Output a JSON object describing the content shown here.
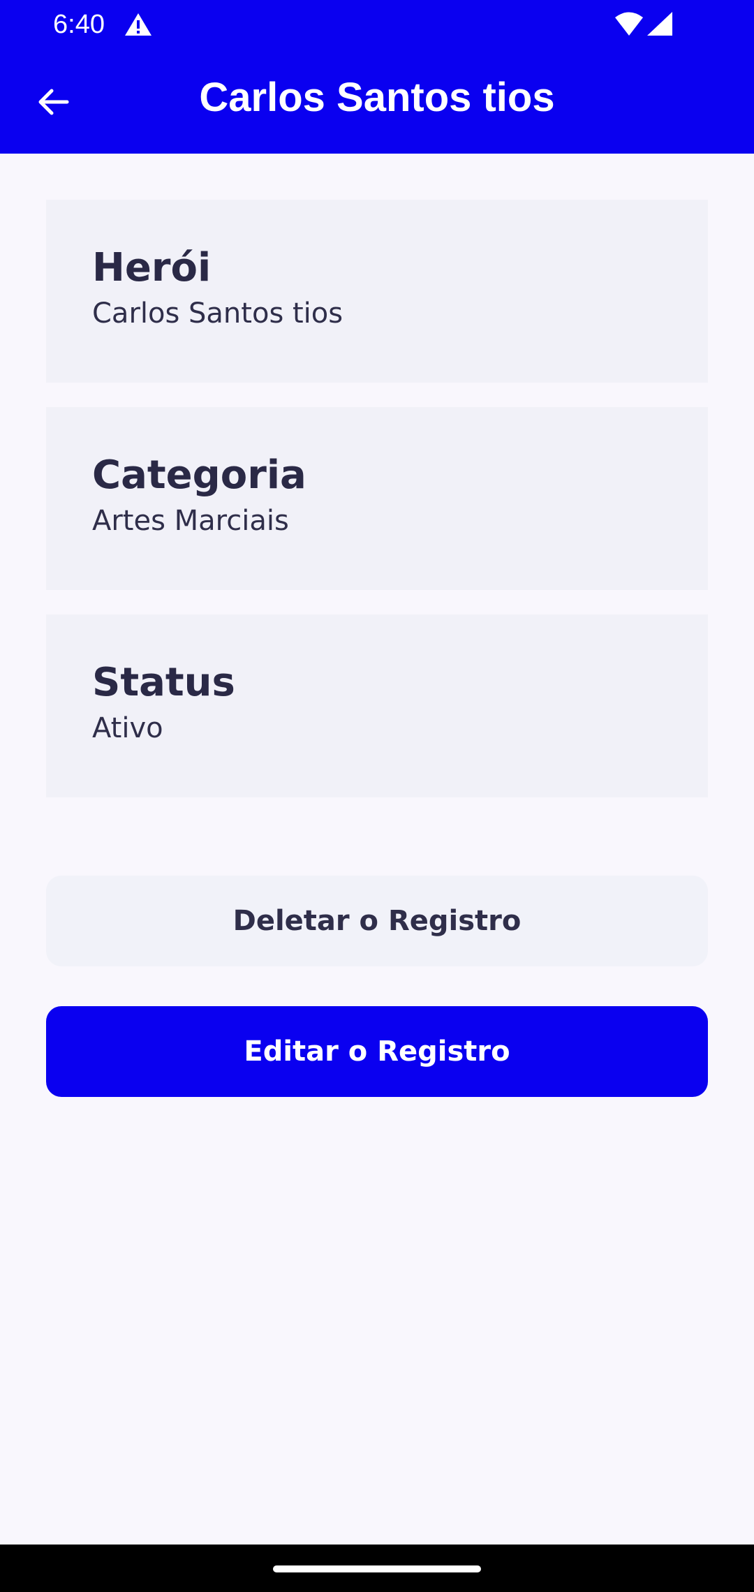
{
  "status_bar": {
    "time": "6:40",
    "icons": [
      "warning-icon",
      "wifi-icon",
      "cell-signal-icon"
    ]
  },
  "app_bar": {
    "title": "Carlos Santos tios",
    "back_icon": "arrow-back-icon"
  },
  "details": [
    {
      "label": "Herói",
      "value": "Carlos Santos tios"
    },
    {
      "label": "Categoria",
      "value": "Artes Marciais"
    },
    {
      "label": "Status",
      "value": "Ativo"
    }
  ],
  "actions": {
    "delete_label": "Deletar o Registro",
    "edit_label": "Editar o Registro"
  },
  "colors": {
    "primary": "#0A00F0",
    "background": "#F9F7FD",
    "card": "#F1F1F8",
    "text": "#2A2946"
  }
}
